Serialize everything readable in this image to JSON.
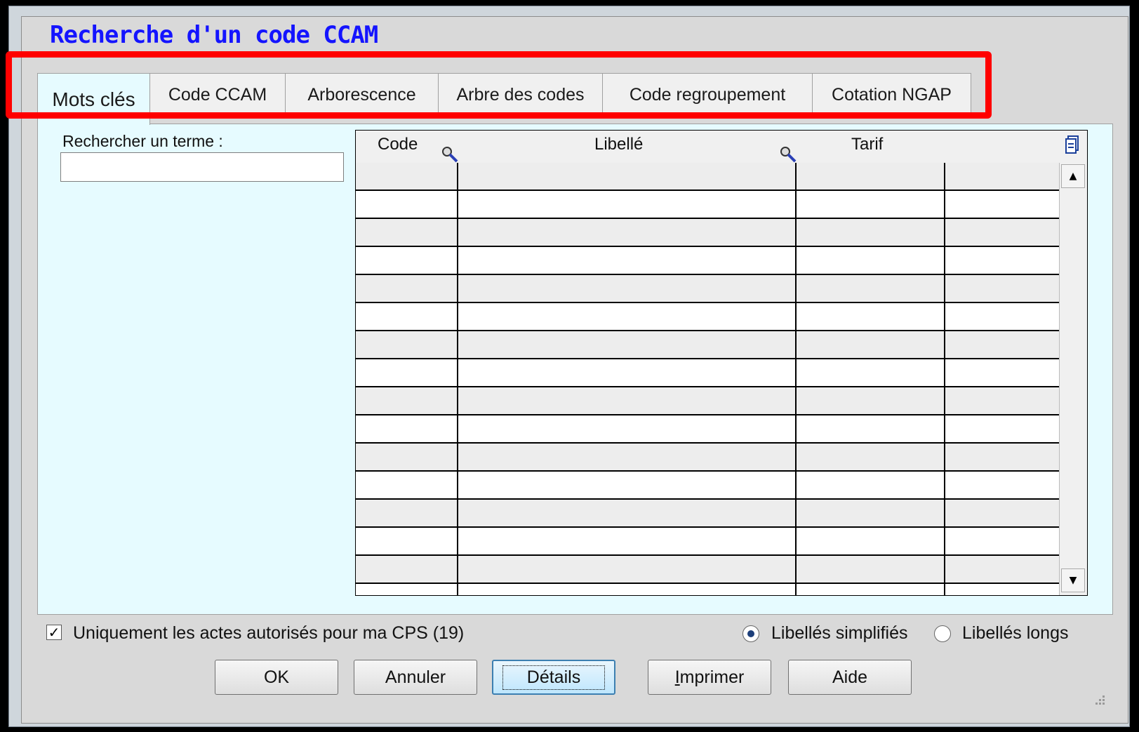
{
  "window": {
    "title": "Recherche d'un code CCAM"
  },
  "tabs": [
    {
      "label": "Mots clés",
      "active": true
    },
    {
      "label": "Code CCAM",
      "active": false
    },
    {
      "label": "Arborescence",
      "active": false
    },
    {
      "label": "Arbre des codes",
      "active": false
    },
    {
      "label": "Code regroupement",
      "active": false
    },
    {
      "label": "Cotation NGAP",
      "active": false
    }
  ],
  "search": {
    "label": "Rechercher un terme :",
    "value": "",
    "placeholder": ""
  },
  "grid": {
    "columns": [
      "Code",
      "Libellé",
      "Tarif"
    ],
    "row_count": 16
  },
  "options": {
    "only_authorized": {
      "label": "Uniquement les actes autorisés pour ma CPS (19)",
      "checked": true
    },
    "label_mode": {
      "simplified": {
        "label": "Libellés simplifiés",
        "selected": true
      },
      "long": {
        "label": "Libellés longs",
        "selected": false
      }
    }
  },
  "buttons": {
    "ok": "OK",
    "cancel": "Annuler",
    "details": "Détails",
    "print": "Imprimer",
    "help": "Aide"
  },
  "colors": {
    "title": "#1414ff",
    "panel": "#e6fbff",
    "highlight": "#ff0000"
  },
  "icons": {
    "sort": "magnifier-icon",
    "copy": "copy-icon",
    "check": "checkmark-icon"
  }
}
